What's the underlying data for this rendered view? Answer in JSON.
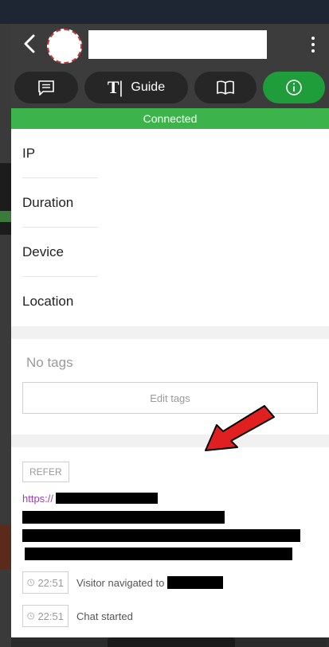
{
  "toolbar": {
    "guide_label": "Guide"
  },
  "status": {
    "label": "Connected"
  },
  "details": {
    "rows": [
      {
        "label": "IP"
      },
      {
        "label": "Duration"
      },
      {
        "label": "Device"
      },
      {
        "label": "Location"
      }
    ]
  },
  "tags": {
    "empty_text": "No tags",
    "edit_label": "Edit tags"
  },
  "history": {
    "refer_label": "REFER",
    "url_prefix": "https://",
    "events": [
      {
        "time": "22:51",
        "text": "Visitor navigated to"
      },
      {
        "time": "22:51",
        "text": "Chat started"
      }
    ]
  },
  "colors": {
    "header_bg": "#3c3c3c",
    "status_green": "#3cb44b",
    "info_button_green": "#1f9d3a",
    "link_purple": "#9b3fb3",
    "annotation_arrow": "#e02020"
  },
  "icons": {
    "back": "chevron-left-icon",
    "menu": "more-vertical-icon",
    "chat": "chat-icon",
    "guide": "text-cursor-icon",
    "book": "book-icon",
    "info": "info-icon",
    "clock": "clock-icon"
  }
}
